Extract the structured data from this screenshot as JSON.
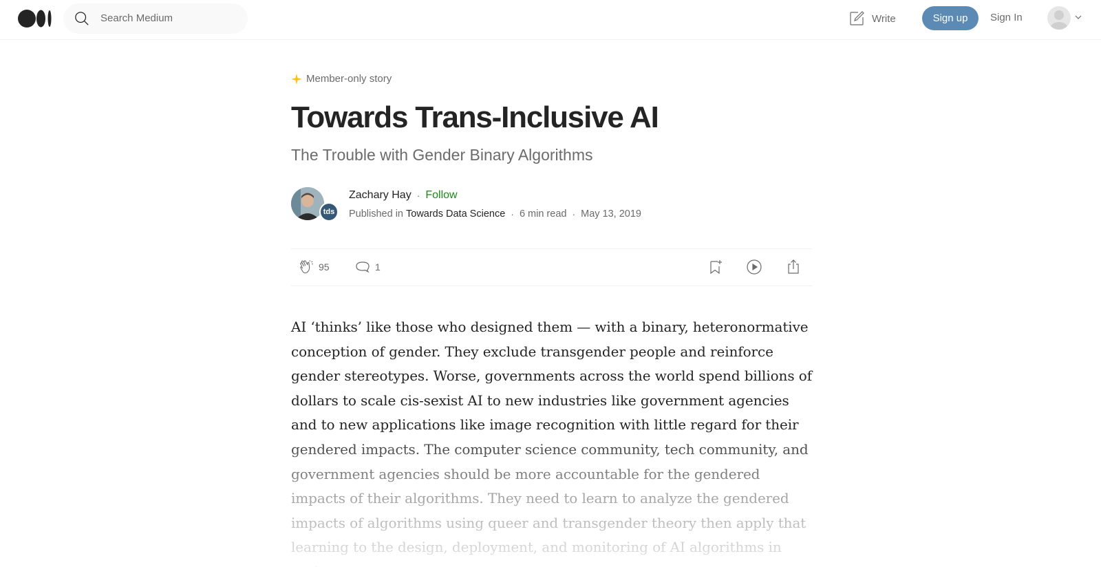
{
  "header": {
    "search_placeholder": "Search Medium",
    "write_label": "Write",
    "signup_label": "Sign up",
    "signin_label": "Sign In"
  },
  "article": {
    "badge": "Member-only story",
    "title": "Towards Trans-Inclusive AI",
    "subtitle": "The Trouble with Gender Binary Algorithms",
    "author": "Zachary Hay",
    "follow_label": "Follow",
    "published_in_prefix": "Published in",
    "publication": "Towards Data Science",
    "publication_badge": "tds",
    "read_time": "6 min read",
    "date": "May 13, 2019",
    "claps": "95",
    "responses": "1",
    "body": "AI ‘thinks’ like those who designed them — with a binary, heteronormative conception of gender. They exclude transgender people and reinforce gender stereotypes. Worse, governments across the world spend billions of dollars to scale cis-sexist AI to new industries like government agencies and to new applications like image recognition with little regard for their gendered impacts. The computer science community, tech community, and government agencies should be more accountable for the gendered impacts of their algorithms. They need to learn to analyze the gendered impacts of algorithms using queer and transgender theory then apply that learning to the design, deployment, and monitoring of AI algorithms in society."
  },
  "icons": {
    "logo": "medium-logo",
    "search": "search-icon",
    "write": "write-icon",
    "member": "star-icon",
    "clap": "clap-icon",
    "response": "comment-icon",
    "save": "bookmark-add-icon",
    "listen": "play-icon",
    "share": "share-icon"
  },
  "colors": {
    "accent_green": "#1a8917",
    "signup_blue": "#5b8ab4",
    "member_star": "#ffc017"
  }
}
